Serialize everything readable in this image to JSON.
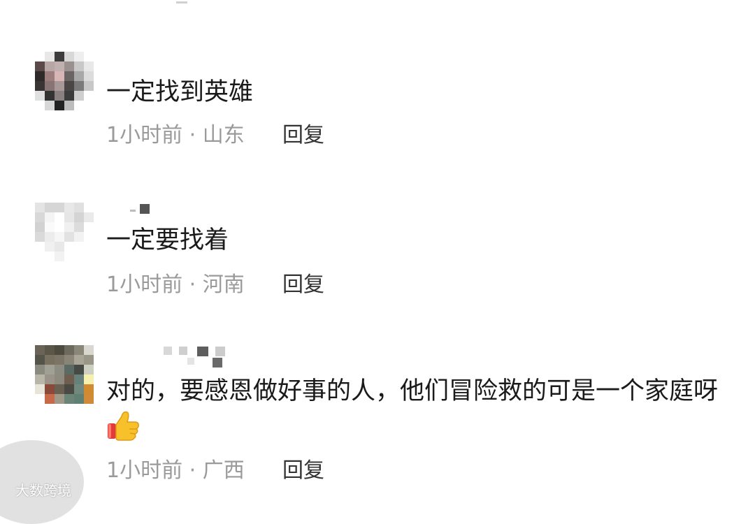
{
  "comments": [
    {
      "text": "一定找到英雄",
      "time": "1小时前",
      "separator": "·",
      "location": "山东",
      "reply_label": "回复"
    },
    {
      "text": "一定要找着",
      "time": "1小时前",
      "separator": "·",
      "location": "河南",
      "reply_label": "回复"
    },
    {
      "text": "对的，要感恩做好事的人，他们冒险救的可是一个家庭呀",
      "emoji": "thumbs-up-icon",
      "time": "1小时前",
      "separator": "·",
      "location": "广西",
      "reply_label": "回复"
    }
  ],
  "watermark": {
    "text": "大数跨境"
  },
  "colors": {
    "text": "#1a1a1a",
    "meta": "#9a9a9a",
    "reply": "#333333"
  }
}
